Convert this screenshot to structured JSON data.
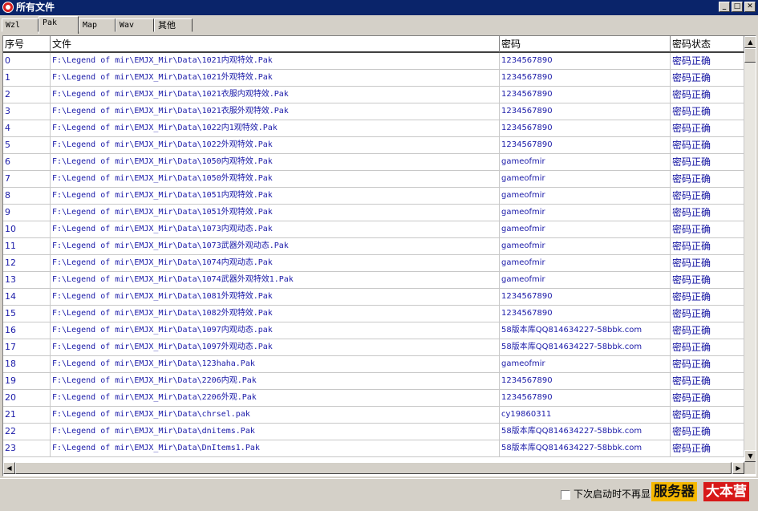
{
  "window": {
    "title": "所有文件",
    "controls": {
      "minimize": "_",
      "maximize": "□",
      "close": "✕"
    }
  },
  "tabs": [
    {
      "label": "Wzl"
    },
    {
      "label": "Pak"
    },
    {
      "label": "Map"
    },
    {
      "label": "Wav"
    },
    {
      "label": "其他"
    }
  ],
  "active_tab": "Pak",
  "table": {
    "columns": [
      "序号",
      "文件",
      "密码",
      "密码状态"
    ],
    "rows": [
      [
        "0",
        "F:\\Legend of mir\\EMJX_Mir\\Data\\1021内观特效.Pak",
        "1234567890",
        "密码正确"
      ],
      [
        "1",
        "F:\\Legend of mir\\EMJX_Mir\\Data\\1021外观特效.Pak",
        "1234567890",
        "密码正确"
      ],
      [
        "2",
        "F:\\Legend of mir\\EMJX_Mir\\Data\\1021衣服内观特效.Pak",
        "1234567890",
        "密码正确"
      ],
      [
        "3",
        "F:\\Legend of mir\\EMJX_Mir\\Data\\1021衣服外观特效.Pak",
        "1234567890",
        "密码正确"
      ],
      [
        "4",
        "F:\\Legend of mir\\EMJX_Mir\\Data\\1022内1观特效.Pak",
        "1234567890",
        "密码正确"
      ],
      [
        "5",
        "F:\\Legend of mir\\EMJX_Mir\\Data\\1022外观特效.Pak",
        "1234567890",
        "密码正确"
      ],
      [
        "6",
        "F:\\Legend of mir\\EMJX_Mir\\Data\\1050内观特效.Pak",
        "gameofmir",
        "密码正确"
      ],
      [
        "7",
        "F:\\Legend of mir\\EMJX_Mir\\Data\\1050外观特效.Pak",
        "gameofmir",
        "密码正确"
      ],
      [
        "8",
        "F:\\Legend of mir\\EMJX_Mir\\Data\\1051内观特效.Pak",
        "gameofmir",
        "密码正确"
      ],
      [
        "9",
        "F:\\Legend of mir\\EMJX_Mir\\Data\\1051外观特效.Pak",
        "gameofmir",
        "密码正确"
      ],
      [
        "10",
        "F:\\Legend of mir\\EMJX_Mir\\Data\\1073内观动态.Pak",
        "gameofmir",
        "密码正确"
      ],
      [
        "11",
        "F:\\Legend of mir\\EMJX_Mir\\Data\\1073武器外观动态.Pak",
        "gameofmir",
        "密码正确"
      ],
      [
        "12",
        "F:\\Legend of mir\\EMJX_Mir\\Data\\1074内观动态.Pak",
        "gameofmir",
        "密码正确"
      ],
      [
        "13",
        "F:\\Legend of mir\\EMJX_Mir\\Data\\1074武器外观特效1.Pak",
        "gameofmir",
        "密码正确"
      ],
      [
        "14",
        "F:\\Legend of mir\\EMJX_Mir\\Data\\1081外观特效.Pak",
        "1234567890",
        "密码正确"
      ],
      [
        "15",
        "F:\\Legend of mir\\EMJX_Mir\\Data\\1082外观特效.Pak",
        "1234567890",
        "密码正确"
      ],
      [
        "16",
        "F:\\Legend of mir\\EMJX_Mir\\Data\\1097内观动态.pak",
        "58版本库QQ814634227-58bbk.com",
        "密码正确"
      ],
      [
        "17",
        "F:\\Legend of mir\\EMJX_Mir\\Data\\1097外观动态.Pak",
        "58版本库QQ814634227-58bbk.com",
        "密码正确"
      ],
      [
        "18",
        "F:\\Legend of mir\\EMJX_Mir\\Data\\123haha.Pak",
        "gameofmir",
        "密码正确"
      ],
      [
        "19",
        "F:\\Legend of mir\\EMJX_Mir\\Data\\2206内观.Pak",
        "1234567890",
        "密码正确"
      ],
      [
        "20",
        "F:\\Legend of mir\\EMJX_Mir\\Data\\2206外观.Pak",
        "1234567890",
        "密码正确"
      ],
      [
        "21",
        "F:\\Legend of mir\\EMJX_Mir\\Data\\chrsel.pak",
        "cy19860311",
        "密码正确"
      ],
      [
        "22",
        "F:\\Legend of mir\\EMJX_Mir\\Data\\dnitems.Pak",
        "58版本库QQ814634227-58bbk.com",
        "密码正确"
      ],
      [
        "23",
        "F:\\Legend of mir\\EMJX_Mir\\Data\\DnItems1.Pak",
        "58版本库QQ814634227-58bbk.com",
        "密码正确"
      ]
    ]
  },
  "footer": {
    "checkbox_label": "下次启动时不再显",
    "checkbox_checked": false
  },
  "watermark": {
    "part1": "服务器",
    "part2": "大本营"
  }
}
